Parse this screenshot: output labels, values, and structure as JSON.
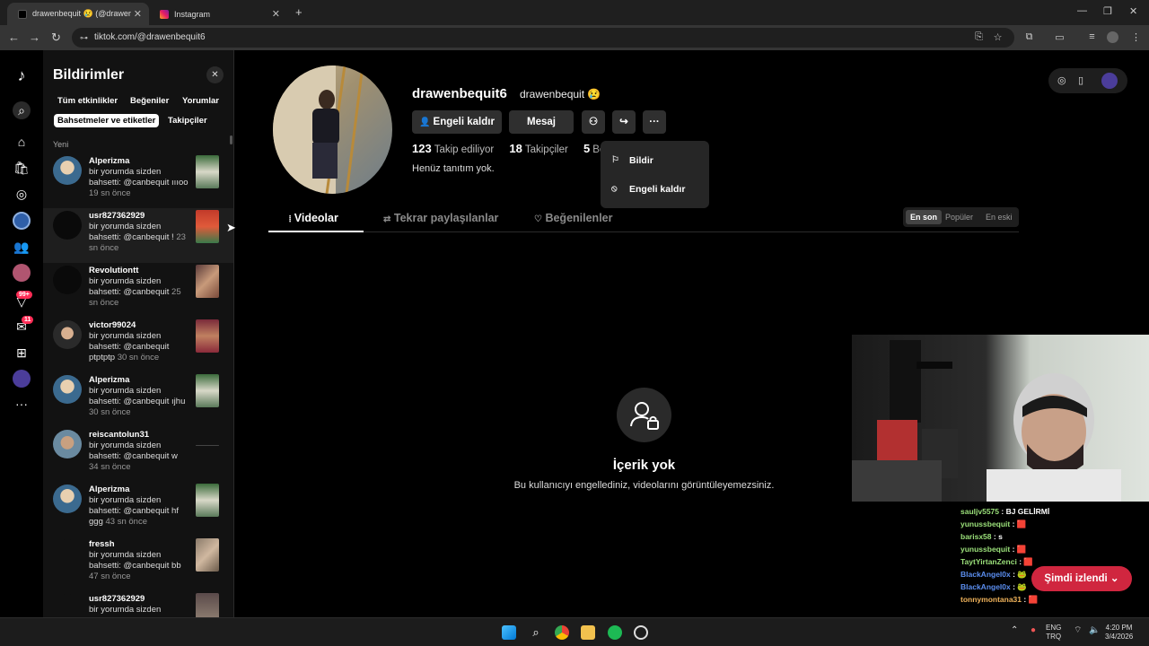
{
  "browser": {
    "tabs": [
      {
        "title": "drawenbequit 😢 (@drawenbe"
      },
      {
        "title": "Instagram"
      }
    ],
    "url": "tiktok.com/@drawenbequit6"
  },
  "notifications": {
    "title": "Bildirimler",
    "filters": [
      "Tüm etkinlikler",
      "Beğeniler",
      "Yorumlar",
      "Bahsetmeler ve etiketler",
      "Takipçiler"
    ],
    "selected_filter": "Bahsetmeler ve etiketler",
    "section": "Yeni",
    "items": [
      {
        "user": "Alperizma",
        "text": "bir yorumda sizden bahsetti: @canbequit ıııoo",
        "time": "19 sn önce"
      },
      {
        "user": "usr827362929",
        "text": "bir yorumda sizden bahsetti: @canbequit !",
        "time": "23 sn önce"
      },
      {
        "user": "Revolutiontt",
        "text": "bir yorumda sizden bahsetti: @canbequit",
        "time": "25 sn önce"
      },
      {
        "user": "victor99024",
        "text": "bir yorumda sizden bahsetti: @canbequit ptptptp",
        "time": "30 sn önce"
      },
      {
        "user": "Alperizma",
        "text": "bir yorumda sizden bahsetti: @canbequit ıjhu",
        "time": "30 sn önce"
      },
      {
        "user": "reiscantolun31",
        "text": "bir yorumda sizden bahsetti: @canbequit w",
        "time": "34 sn önce"
      },
      {
        "user": "Alperizma",
        "text": "bir yorumda sizden bahsetti: @canbequit hf ggg",
        "time": "43 sn önce"
      },
      {
        "user": "fressh",
        "text": "bir yorumda sizden bahsetti: @canbequit bb",
        "time": "47 sn önce"
      },
      {
        "user": "usr827362929",
        "text": "bir yorumda sizden",
        "time": ""
      }
    ]
  },
  "rail": {
    "badge_activity": "99+",
    "badge_messages": "11"
  },
  "profile": {
    "username": "drawenbequit6",
    "nickname": "drawenbequit 😢",
    "unblock_button": "Engeli kaldır",
    "message_button": "Mesaj",
    "following_count": "123",
    "following_label": "Takip ediliyor",
    "followers_count": "18",
    "followers_label": "Takipçiler",
    "likes_count": "5",
    "likes_label": "Beğ",
    "bio": "Henüz tanıtım yok.",
    "menu": {
      "report": "Bildir",
      "unblock": "Engeli kaldır"
    },
    "tabs": [
      "Videolar",
      "Tekrar paylaşılanlar",
      "Beğenilenler"
    ],
    "sort_options": [
      "En son",
      "Popüler",
      "En eski"
    ],
    "empty_title": "İçerik yok",
    "empty_subtitle": "Bu kullanıcıyı engellediniz, videolarını görüntüleyemezsiniz."
  },
  "stream": {
    "chat": [
      {
        "user": "sauljv5575",
        "msg": "BJ GELİRMİ"
      },
      {
        "user": "yunussbequit",
        "msg": "🟥"
      },
      {
        "user": "barisx58",
        "msg": "s"
      },
      {
        "user": "yunussbequit",
        "msg": "🟥"
      },
      {
        "user": "TaytYirtanZenci",
        "msg": "🟥"
      },
      {
        "user": "BlackAngel0x",
        "msg": "🐸"
      },
      {
        "user": "BlackAngel0x",
        "msg": "🐸"
      },
      {
        "user": "tonnymontana31",
        "msg": "🟥"
      }
    ],
    "watching_label": "Şimdi izlendi"
  },
  "taskbar": {
    "lang_top": "ENG",
    "lang_bottom": "TRQ",
    "time": "4:20 PM",
    "date": "3/4/2026"
  }
}
